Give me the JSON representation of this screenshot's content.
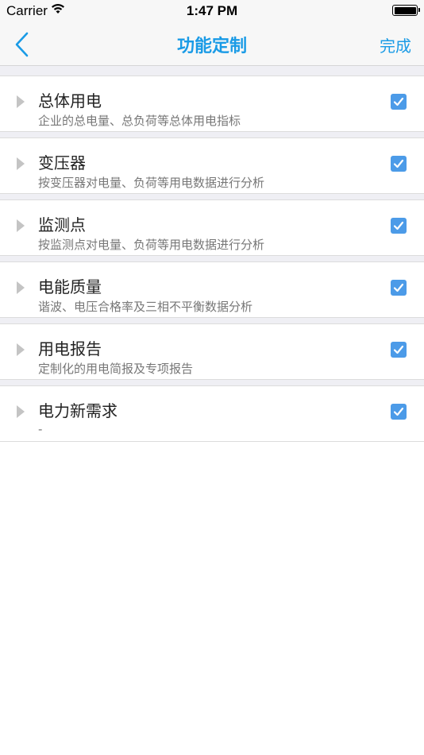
{
  "status_bar": {
    "carrier": "Carrier",
    "time": "1:47 PM"
  },
  "nav": {
    "title": "功能定制",
    "done_label": "完成",
    "accent_color": "#1a9be6"
  },
  "items": [
    {
      "title": "总体用电",
      "subtitle": "企业的总电量、总负荷等总体用电指标",
      "checked": true
    },
    {
      "title": "变压器",
      "subtitle": "按变压器对电量、负荷等用电数据进行分析",
      "checked": true
    },
    {
      "title": "监测点",
      "subtitle": "按监测点对电量、负荷等用电数据进行分析",
      "checked": true
    },
    {
      "title": "电能质量",
      "subtitle": "谐波、电压合格率及三相不平衡数据分析",
      "checked": true
    },
    {
      "title": "用电报告",
      "subtitle": "定制化的用电简报及专项报告",
      "checked": true
    },
    {
      "title": "电力新需求",
      "subtitle": "-",
      "checked": true
    }
  ]
}
